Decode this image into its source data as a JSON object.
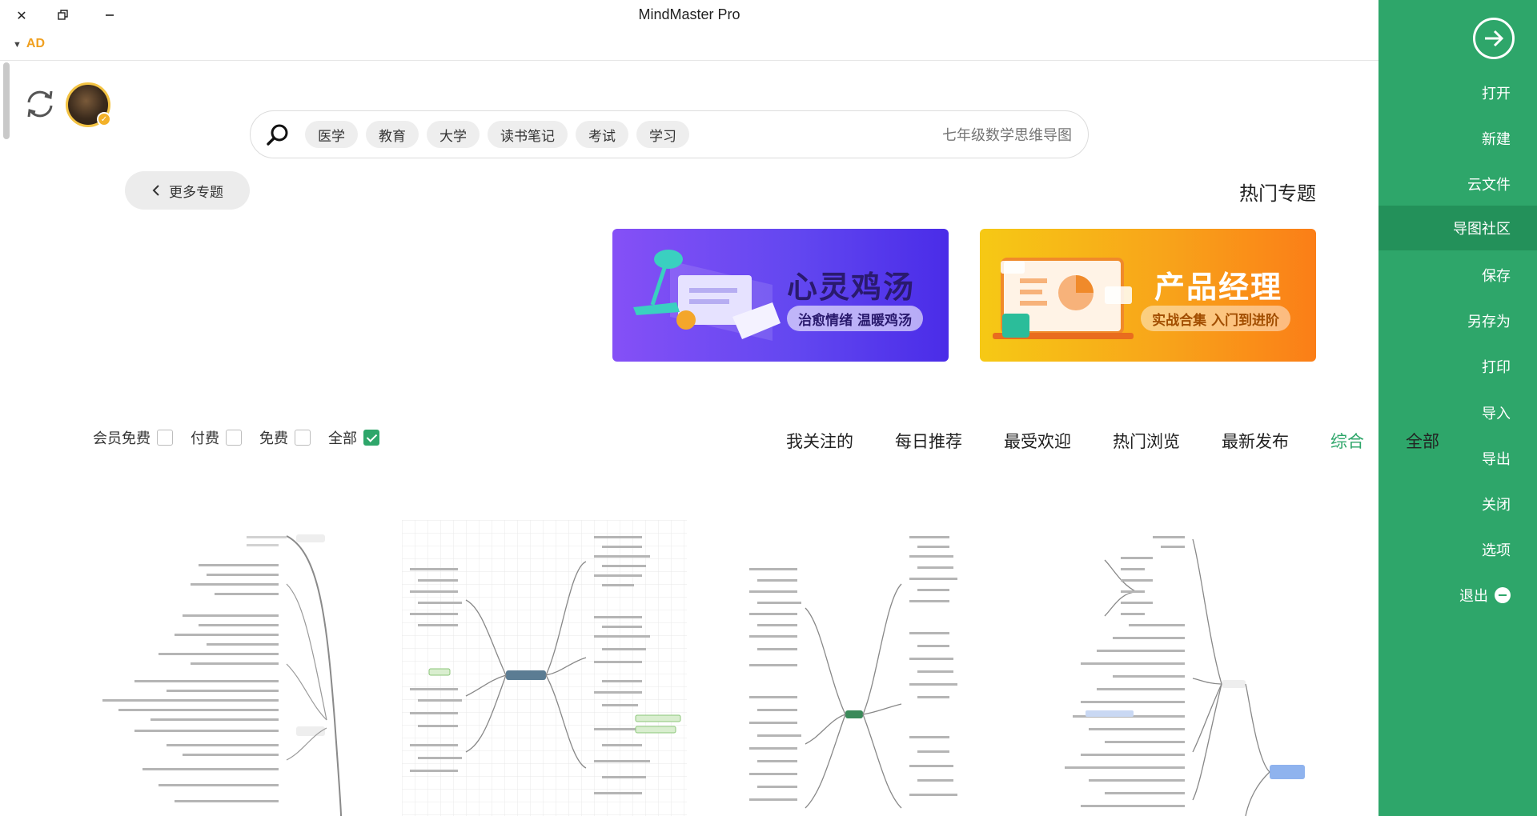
{
  "window": {
    "title": "MindMaster Pro",
    "ad_label": "AD"
  },
  "sidebar": {
    "items": [
      {
        "label": "打开"
      },
      {
        "label": "新建"
      },
      {
        "label": "云文件"
      },
      {
        "label": "导图社区",
        "active": true
      },
      {
        "label": "保存"
      },
      {
        "label": "另存为"
      },
      {
        "label": "打印"
      },
      {
        "label": "导入"
      },
      {
        "label": "导出"
      },
      {
        "label": "关闭"
      },
      {
        "label": "选项"
      },
      {
        "label": "退出"
      }
    ],
    "color": "#2ea66a"
  },
  "search": {
    "placeholder": "七年级数学思维导图",
    "chips": [
      "学习",
      "考试",
      "读书笔记",
      "大学",
      "教育",
      "医学"
    ]
  },
  "hot": {
    "title": "热门专题",
    "more_label": "更多专题",
    "banners": [
      {
        "title": "产品经理",
        "subtitle": "实战合集 入门到进阶"
      },
      {
        "title": "心灵鸡汤",
        "subtitle": "治愈情绪 温暖鸡汤"
      }
    ]
  },
  "tabs": [
    "全部",
    "综合",
    "最新发布",
    "热门浏览",
    "最受欢迎",
    "每日推荐",
    "我关注的"
  ],
  "active_tab": "综合",
  "accent_color": "#2ea66a",
  "filters": [
    {
      "label": "全部",
      "checked": true
    },
    {
      "label": "免费",
      "checked": false
    },
    {
      "label": "付费",
      "checked": false
    },
    {
      "label": "会员免费",
      "checked": false
    }
  ]
}
